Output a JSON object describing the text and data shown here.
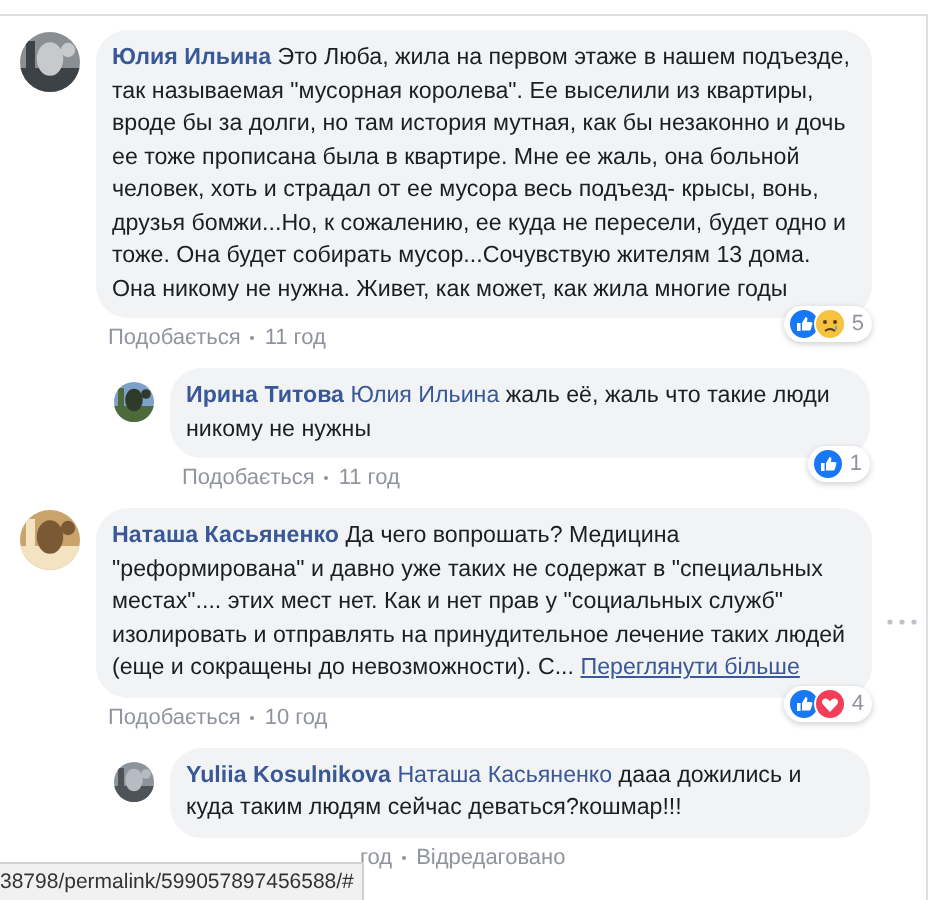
{
  "comments": [
    {
      "author": "Юлия Ильина",
      "text": "Это Люба, жила на первом этаже в нашем подъезде, так называемая \"мусорная королева\". Ее выселили из квартиры, вроде бы за долги, но там история мутная, как бы незаконно и дочь ее тоже прописана была в квартире. Мне ее жаль, она больной человек, хоть и страдал от ее мусора весь подъезд- крысы, вонь, друзья бомжи...Но, к сожалению, ее куда не пересели, будет одно и тоже. Она будет собирать мусор...Сочувствую жителям 13 дома. Она никому не нужна. Живет, как может, как жила многие годы",
      "reactions": {
        "icons": [
          {
            "kind": "like"
          },
          {
            "kind": "sad"
          }
        ],
        "count": "5"
      },
      "meta": {
        "like": "Подобається",
        "time": "11 год"
      },
      "replies": [
        {
          "author": "Ирина Титова",
          "mention": "Юлия Ильина",
          "text": "жаль её, жаль что такие люди никому не нужны",
          "reactions": {
            "icons": [
              {
                "kind": "like"
              }
            ],
            "count": "1"
          },
          "meta": {
            "like": "Подобається",
            "time": "11 год"
          }
        }
      ]
    },
    {
      "author": "Наташа Касьяненко",
      "text": "Да чего вопрошать? Медицина \"реформирована\" и давно уже таких не содержат в \"специальных местах\".... этих мест нет. Как и нет прав у \"социальных служб\" изолировать и отправлять на принудительное лечение таких людей (еще и сокращены до невозможности). С...",
      "see_more": "Переглянути більше",
      "menu": true,
      "reactions": {
        "icons": [
          {
            "kind": "like"
          },
          {
            "kind": "love"
          }
        ],
        "count": "4"
      },
      "meta": {
        "like": "Подобається",
        "time": "10 год"
      },
      "replies": [
        {
          "author": "Yuliia Kosulnikova",
          "mention": "Наташа Касьяненко",
          "text": "дааа дожились и куда таким людям сейчас деваться?кошмар!!!",
          "meta": {
            "time": "год",
            "edited": "Відредаговано"
          }
        }
      ]
    }
  ],
  "status_url": "38798/permalink/599057897456588/#"
}
